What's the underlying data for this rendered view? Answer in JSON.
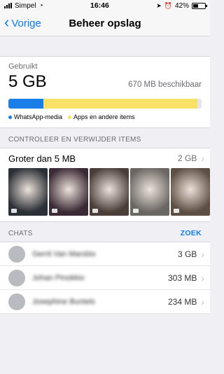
{
  "status_bar": {
    "carrier": "Simpel",
    "time": "16:46",
    "battery": "42%",
    "battery_level": 0.42
  },
  "nav": {
    "back_label": "Vorige",
    "title": "Beheer opslag"
  },
  "storage": {
    "used_label": "Gebruikt",
    "used_value": "5 GB",
    "available": "670 MB beschikbaar",
    "bar": [
      {
        "name": "WhatsApp-media",
        "fraction": 0.18,
        "color": "#1a7ee8"
      },
      {
        "name": "Apps en andere items",
        "fraction": 0.8,
        "color": "#f9e066"
      }
    ],
    "legend": [
      "WhatsApp-media",
      "Apps en andere items"
    ]
  },
  "review": {
    "header": "CONTROLEER EN VERWIJDER ITEMS",
    "row_label": "Groter dan 5 MB",
    "row_size": "2 GB",
    "thumbs": [
      {
        "bg": "#2b2f36"
      },
      {
        "bg": "#3a2a35"
      },
      {
        "bg": "#4a3e38"
      },
      {
        "bg": "#6a6662"
      },
      {
        "bg": "#5e4f44"
      }
    ]
  },
  "chats": {
    "header": "CHATS",
    "search_label": "ZOEK",
    "items": [
      {
        "name": "Gerrit Van Marsbix",
        "size": "3 GB"
      },
      {
        "name": "Johan Pinokkio",
        "size": "303 MB"
      },
      {
        "name": "Josephine Buntels",
        "size": "234 MB"
      }
    ]
  }
}
